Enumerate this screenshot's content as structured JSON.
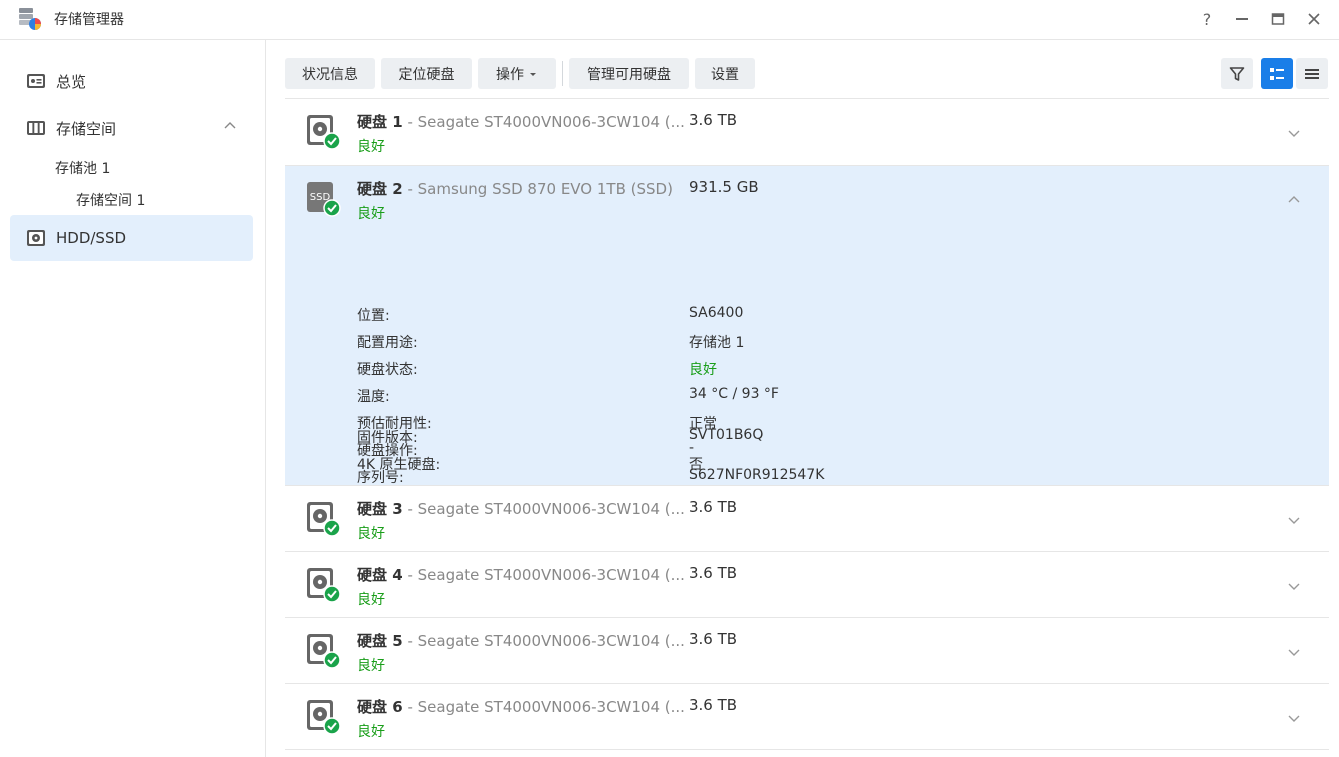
{
  "app": {
    "title": "存储管理器"
  },
  "window": {
    "help": "?",
    "minimize": "–",
    "maximize": "▭",
    "close": "✕"
  },
  "sidebar": {
    "items": [
      {
        "label": "总览"
      },
      {
        "label": "存储空间"
      },
      {
        "label": "HDD/SSD"
      }
    ],
    "subitems": [
      {
        "label": "存储池 1"
      },
      {
        "label": "存储空间 1"
      }
    ]
  },
  "toolbar": {
    "status": "状况信息",
    "locate": "定位硬盘",
    "action": "操作",
    "manage": "管理可用硬盘",
    "settings": "设置"
  },
  "colors": {
    "accent": "#1a7ee8",
    "ok": "#1a9e1a",
    "selected_bg": "#e3effc"
  },
  "disks": [
    {
      "name": "硬盘 1",
      "model": " - Seagate ST4000VN006-3CW104 (...",
      "size": "3.6 TB",
      "status": "良好",
      "icon": "hdd-icon"
    },
    {
      "name": "硬盘 2",
      "model": " - Samsung SSD 870 EVO 1TB (SSD)",
      "size": "931.5 GB",
      "status": "良好",
      "icon": "ssd-icon",
      "icon_text": "SSD",
      "details": [
        {
          "label": "位置:",
          "value": "SA6400"
        },
        {
          "label": "配置用途:",
          "value": "存储池 1"
        },
        {
          "label": "硬盘状态:",
          "value": "良好"
        },
        {
          "label": "温度:",
          "value": "34 °C / 93 °F"
        },
        {
          "label": "预估耐用性:",
          "value": "正常"
        },
        {
          "label": "硬盘操作:",
          "value": "-"
        },
        {
          "label": "序列号:",
          "value": "S627NF0R912547K"
        },
        {
          "label": "固件版本:",
          "value": "SVT01B6Q"
        },
        {
          "label": "4K 原生硬盘:",
          "value": "否"
        }
      ]
    },
    {
      "name": "硬盘 3",
      "model": " - Seagate ST4000VN006-3CW104 (...",
      "size": "3.6 TB",
      "status": "良好",
      "icon": "hdd-icon"
    },
    {
      "name": "硬盘 4",
      "model": " - Seagate ST4000VN006-3CW104 (...",
      "size": "3.6 TB",
      "status": "良好",
      "icon": "hdd-icon"
    },
    {
      "name": "硬盘 5",
      "model": " - Seagate ST4000VN006-3CW104 (...",
      "size": "3.6 TB",
      "status": "良好",
      "icon": "hdd-icon"
    },
    {
      "name": "硬盘 6",
      "model": " - Seagate ST4000VN006-3CW104 (...",
      "size": "3.6 TB",
      "status": "良好",
      "icon": "hdd-icon"
    }
  ]
}
